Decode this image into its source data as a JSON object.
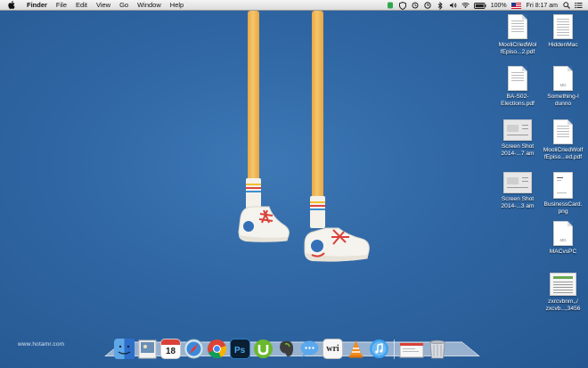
{
  "menubar": {
    "app_name": "Finder",
    "menus": [
      "File",
      "Edit",
      "View",
      "Go",
      "Window",
      "Help"
    ],
    "battery": "100%",
    "clock": "Fri 8:17 am"
  },
  "desktop": {
    "icons": [
      {
        "label1": "MooliCriedWol",
        "label2": "fEpiso...2.pdf"
      },
      {
        "label1": "HiddenMac",
        "label2": ""
      },
      {
        "label1": "BA-S02-",
        "label2": "Elections.pdf"
      },
      {
        "label1": "Something-I",
        "label2": "dunno"
      },
      {
        "label1": "Screen Shot",
        "label2": "2014-...7 am"
      },
      {
        "label1": "MooliCriedWolf",
        "label2": "fEpiso...ed.pdf"
      },
      {
        "label1": "Screen Shot",
        "label2": "2014-...3 am"
      },
      {
        "label1": "BusinessCard.",
        "label2": "png"
      },
      {
        "label1": "MACvsPC",
        "label2": ""
      },
      {
        "label1": "zxrcvbnm,,/",
        "label2": "zxcvb...,3456"
      }
    ],
    "tags": {
      "md": "MD"
    }
  },
  "watermark": "www.hotamr.com",
  "dock": {
    "calendar_day": "18",
    "word_label": "wri"
  }
}
